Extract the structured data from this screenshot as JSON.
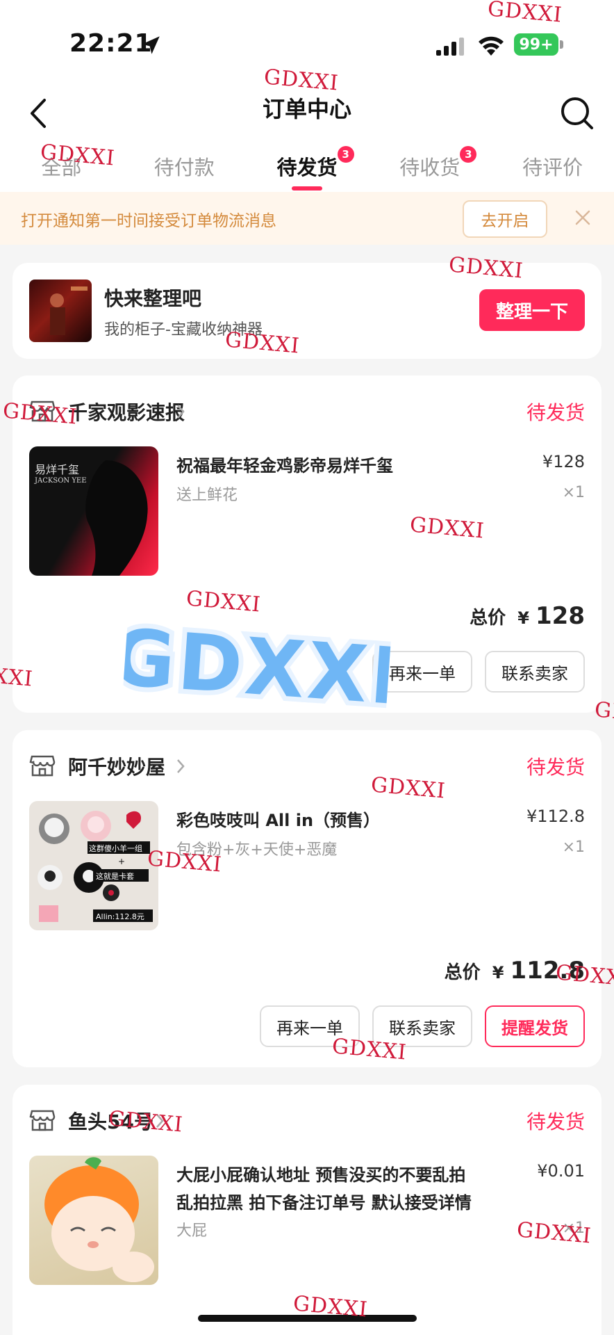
{
  "status_bar": {
    "time": "22:21",
    "battery": "99+"
  },
  "nav": {
    "title": "订单中心"
  },
  "tabs": [
    {
      "label": "全部"
    },
    {
      "label": "待付款"
    },
    {
      "label": "待发货",
      "badge": "3"
    },
    {
      "label": "待收货",
      "badge": "3"
    },
    {
      "label": "待评价"
    }
  ],
  "notice": {
    "text": "打开通知第一时间接受订单物流消息",
    "button": "去开启"
  },
  "promo": {
    "title": "快来整理吧",
    "subtitle": "我的柜子-宝藏收纳神器",
    "button": "整理一下"
  },
  "orders": [
    {
      "shop": "千家观影速报",
      "status": "待发货",
      "title": "祝福最年轻金鸡影帝易烊千玺",
      "spec": "送上鲜花",
      "price": "¥128",
      "qty": "×1",
      "total_label": "总价",
      "currency": "¥",
      "total": "128",
      "thumb_text": [
        "易烊千玺",
        "JACKSON YEE"
      ],
      "buttons": [
        "再来一单",
        "联系卖家"
      ]
    },
    {
      "shop": "阿千妙妙屋",
      "status": "待发货",
      "title": "彩色吱吱叫 All in（预售）",
      "spec": "包含粉+灰+天使+恶魔",
      "price": "¥112.8",
      "qty": "×1",
      "total_label": "总价",
      "currency": "¥",
      "total": "112.8",
      "thumb_text": [
        "这群傻小羊一组",
        "+",
        "这就是卡套",
        "Allin:112.8元"
      ],
      "buttons": [
        "再来一单",
        "联系卖家",
        "提醒发货"
      ]
    },
    {
      "shop": "鱼头54号",
      "status": "待发货",
      "title": "大屁小屁确认地址 预售没买的不要乱拍 乱拍拉黑 拍下备注订单号 默认接受详情",
      "spec": "大屁",
      "price": "¥0.01",
      "qty": "×1"
    }
  ],
  "watermark": "GDXXI",
  "colors": {
    "accent": "#ff2a5a",
    "notice_text": "#d48a3c",
    "watermark": "#d01a3a"
  }
}
